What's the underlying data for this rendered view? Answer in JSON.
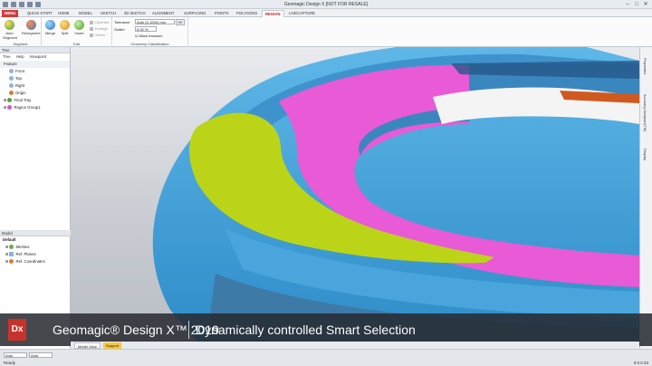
{
  "window": {
    "title": "Geomagic Design X [NOT FOR RESALE]"
  },
  "tabs": [
    {
      "label": "MENU"
    },
    {
      "label": "QUICK START"
    },
    {
      "label": "HOME"
    },
    {
      "label": "MODEL"
    },
    {
      "label": "SKETCH"
    },
    {
      "label": "3D SKETCH"
    },
    {
      "label": "ALIGNMENT"
    },
    {
      "label": "SURFACING"
    },
    {
      "label": "POINTS"
    },
    {
      "label": "POLYGONS"
    },
    {
      "label": "REGION"
    },
    {
      "label": "LIVECAPTURE"
    }
  ],
  "ribbon": {
    "segment": {
      "label": "Segment",
      "auto_segment": "Auto Segment",
      "resegment": "Resegment"
    },
    "edit": {
      "label": "Edit",
      "merge": "Merge",
      "split": "Split",
      "insert": "Insert",
      "small": [
        "Optimize",
        "Enlarge",
        "Shrink"
      ]
    },
    "geometry": {
      "label": "Geometry Classification",
      "tolerance_label": "Tolerance",
      "tolerance_value": "Auto (0.1000) mm",
      "outlier_label": "Outlier",
      "outlier_value": "5.00 %",
      "allow_intrusion": "Allow Intrusion",
      "ok": "OK"
    }
  },
  "left_panel": {
    "tree_tab": "Tree",
    "tools": [
      "Tree",
      "Help",
      "Viewpoint"
    ],
    "feature_header": "Feature",
    "features": [
      "Front",
      "Top",
      "Right",
      "Origin",
      "Final Tray",
      "Region Group1"
    ],
    "model_header": "Model",
    "model_items": [
      "Default",
      "Meshes",
      "Ref. Planes",
      "Ref. Coordinates"
    ]
  },
  "right_strip": [
    "Properties",
    "Accuracy Analyzer(TM)",
    "Display"
  ],
  "banner": {
    "logo": "Dx",
    "product": "Geomagic® Design X™ 2019",
    "subtitle": "Dynamically controlled Smart Selection"
  },
  "bottom_tabs": [
    "Model View",
    "Support"
  ],
  "status": {
    "ready": "Ready",
    "dropdown1": "Auto",
    "dropdown2": "Auto",
    "clock": "0:0.0:33"
  }
}
